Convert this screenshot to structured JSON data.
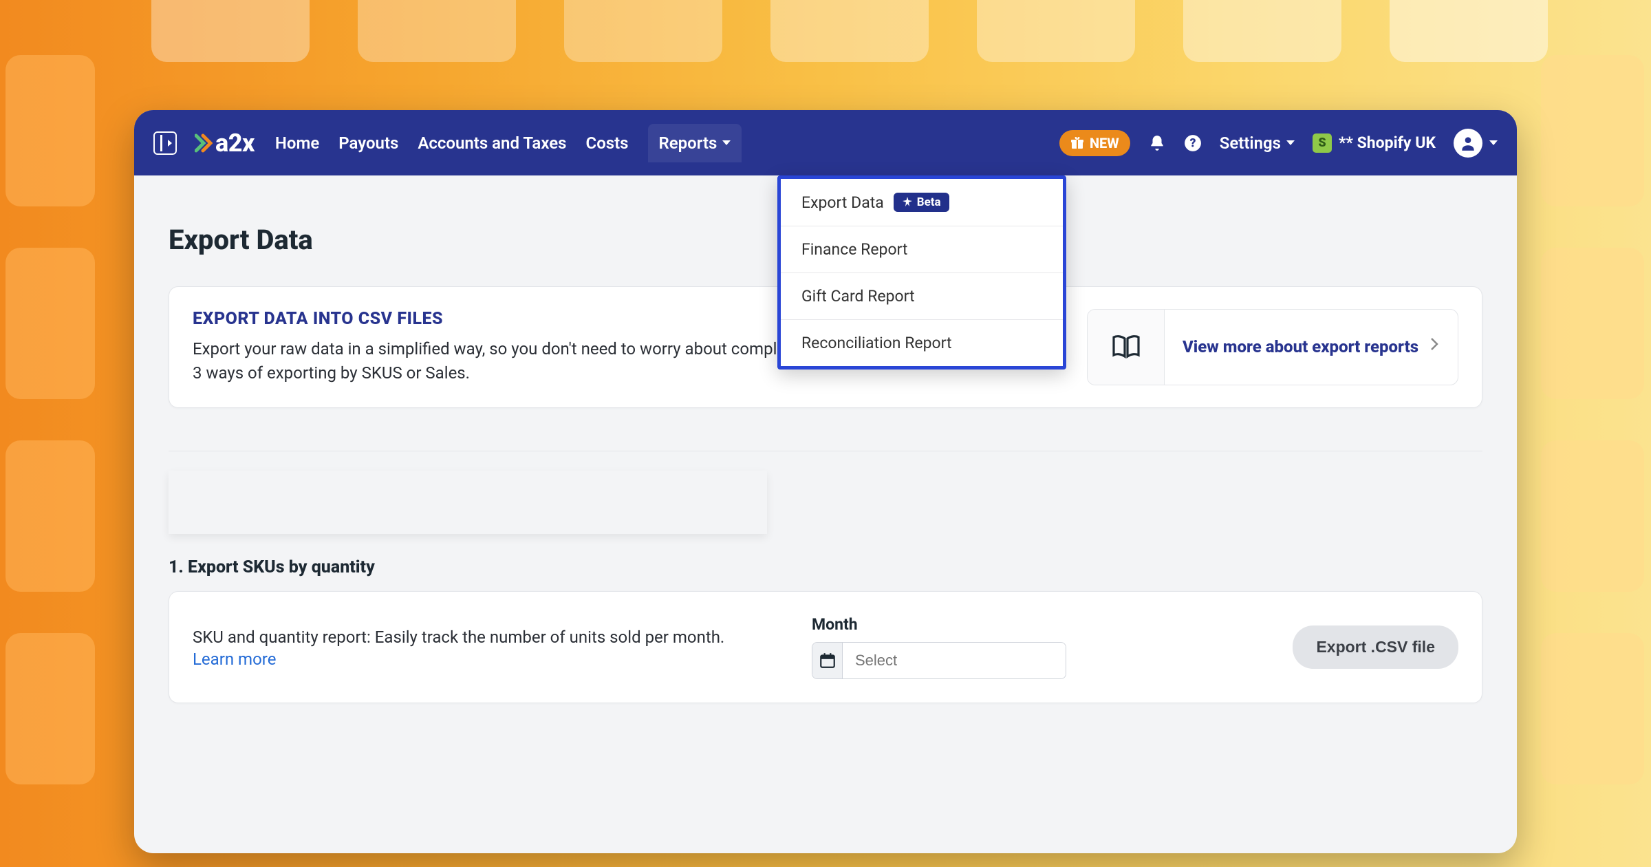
{
  "brand": {
    "name": "a2x"
  },
  "nav": {
    "items": [
      "Home",
      "Payouts",
      "Accounts and Taxes",
      "Costs",
      "Reports"
    ]
  },
  "topbar": {
    "new_badge": "NEW",
    "settings": "Settings",
    "store_name": "** Shopify UK"
  },
  "reports_menu": {
    "items": [
      {
        "label": "Export Data",
        "badge": "Beta"
      },
      {
        "label": "Finance Report"
      },
      {
        "label": "Gift Card Report"
      },
      {
        "label": "Reconciliation Report"
      }
    ]
  },
  "page": {
    "title": "Export Data",
    "intro_title": "EXPORT DATA INTO CSV FILES",
    "intro_desc": "Export your raw data in a simplified way, so you don't need to worry about complex pivot tables. Below are 3 ways of exporting by SKUS or Sales.",
    "view_more": "View more about export reports"
  },
  "section1": {
    "heading": "1. Export SKUs by quantity",
    "desc": "SKU and quantity report: Easily track the number of units sold per month.",
    "learn_more": "Learn more",
    "month_label": "Month",
    "month_placeholder": "Select",
    "export_button": "Export .CSV file"
  }
}
